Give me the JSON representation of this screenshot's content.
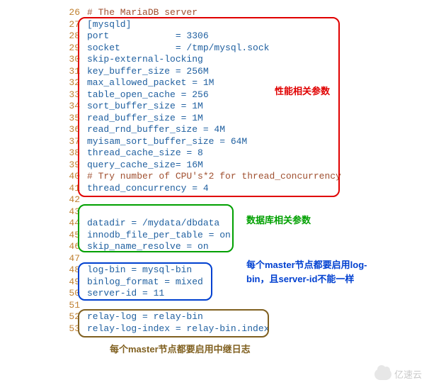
{
  "lines": [
    {
      "n": 26,
      "cls": "comment",
      "t": "# The MariaDB server"
    },
    {
      "n": 27,
      "cls": "code",
      "t": "[mysqld]"
    },
    {
      "n": 28,
      "cls": "code",
      "t": "port            = 3306"
    },
    {
      "n": 29,
      "cls": "code",
      "t": "socket          = /tmp/mysql.sock"
    },
    {
      "n": 30,
      "cls": "code",
      "t": "skip-external-locking"
    },
    {
      "n": 31,
      "cls": "code",
      "t": "key_buffer_size = 256M"
    },
    {
      "n": 32,
      "cls": "code",
      "t": "max_allowed_packet = 1M"
    },
    {
      "n": 33,
      "cls": "code",
      "t": "table_open_cache = 256"
    },
    {
      "n": 34,
      "cls": "code",
      "t": "sort_buffer_size = 1M"
    },
    {
      "n": 35,
      "cls": "code",
      "t": "read_buffer_size = 1M"
    },
    {
      "n": 36,
      "cls": "code",
      "t": "read_rnd_buffer_size = 4M"
    },
    {
      "n": 37,
      "cls": "code",
      "t": "myisam_sort_buffer_size = 64M"
    },
    {
      "n": 38,
      "cls": "code",
      "t": "thread_cache_size = 8"
    },
    {
      "n": 39,
      "cls": "code",
      "t": "query_cache_size= 16M"
    },
    {
      "n": 40,
      "cls": "comment",
      "t": "# Try number of CPU's*2 for thread_concurrency"
    },
    {
      "n": 41,
      "cls": "code",
      "t": "thread_concurrency = 4"
    },
    {
      "n": 42,
      "cls": "code",
      "t": ""
    },
    {
      "n": 43,
      "cls": "code",
      "t": ""
    },
    {
      "n": 44,
      "cls": "code",
      "t": "datadir = /mydata/dbdata"
    },
    {
      "n": 45,
      "cls": "code",
      "t": "innodb_file_per_table = on"
    },
    {
      "n": 46,
      "cls": "code",
      "t": "skip_name_resolve = on"
    },
    {
      "n": 47,
      "cls": "code",
      "t": ""
    },
    {
      "n": 48,
      "cls": "code",
      "t": "log-bin = mysql-bin"
    },
    {
      "n": 49,
      "cls": "code",
      "t": "binlog_format = mixed"
    },
    {
      "n": 50,
      "cls": "code",
      "t": "server-id = 11"
    },
    {
      "n": 51,
      "cls": "code",
      "t": ""
    },
    {
      "n": 52,
      "cls": "code",
      "t": "relay-log = relay-bin"
    },
    {
      "n": 53,
      "cls": "code",
      "t": "relay-log-index = relay-bin.index"
    }
  ],
  "annotations": {
    "red": "性能相关参数",
    "green": "数据库相关参数",
    "blue": "每个master节点都要启用log-bin，且server-id不能一样",
    "brown": "每个master节点都要启用中继日志"
  },
  "watermark": "亿速云"
}
